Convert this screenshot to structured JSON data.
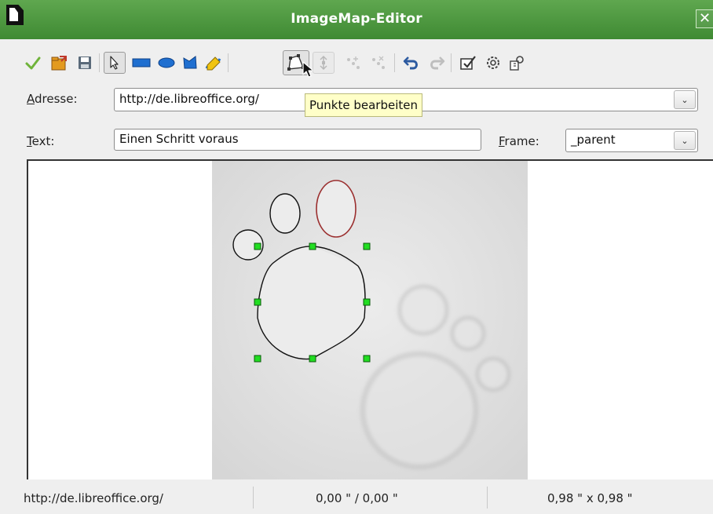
{
  "window": {
    "title": "ImageMap-Editor",
    "close_glyph": "✕"
  },
  "toolbar": {
    "items": [
      {
        "name": "apply-icon",
        "tooltip": ""
      },
      {
        "name": "open-icon",
        "tooltip": ""
      },
      {
        "name": "save-icon",
        "tooltip": ""
      },
      {
        "name": "select-icon",
        "tooltip": ""
      },
      {
        "name": "rectangle-icon",
        "tooltip": ""
      },
      {
        "name": "ellipse-icon",
        "tooltip": ""
      },
      {
        "name": "polygon-icon",
        "tooltip": ""
      },
      {
        "name": "freeform-polygon-icon",
        "tooltip": ""
      },
      {
        "name": "edit-points-icon",
        "tooltip": "Punkte bearbeiten"
      },
      {
        "name": "move-points-icon",
        "tooltip": ""
      },
      {
        "name": "insert-points-icon",
        "tooltip": ""
      },
      {
        "name": "delete-points-icon",
        "tooltip": ""
      },
      {
        "name": "undo-icon",
        "tooltip": ""
      },
      {
        "name": "redo-icon",
        "tooltip": ""
      },
      {
        "name": "active-icon",
        "tooltip": ""
      },
      {
        "name": "macro-icon",
        "tooltip": ""
      },
      {
        "name": "properties-icon",
        "tooltip": ""
      }
    ],
    "tooltip_text": "Punkte bearbeiten"
  },
  "fields": {
    "address_label_mnemonic": "A",
    "address_label_rest": "dresse:",
    "address_value": "http://de.libreoffice.org/",
    "text_label_mnemonic": "T",
    "text_label_rest": "ext:",
    "text_value": "Einen Schritt voraus",
    "frame_label_mnemonic": "F",
    "frame_label_rest": "rame:",
    "frame_value": "_parent",
    "dropdown_glyph": "⌄"
  },
  "colors": {
    "titlebar": "#4c9a41",
    "handle": "#22dd22",
    "selected_outline": "#9b2f2f",
    "shape_outline": "#111111"
  },
  "status": {
    "url": "http://de.libreoffice.org/",
    "position": "0,00 \" / 0,00 \"",
    "size": "0,98 \" x 0,98 \""
  }
}
